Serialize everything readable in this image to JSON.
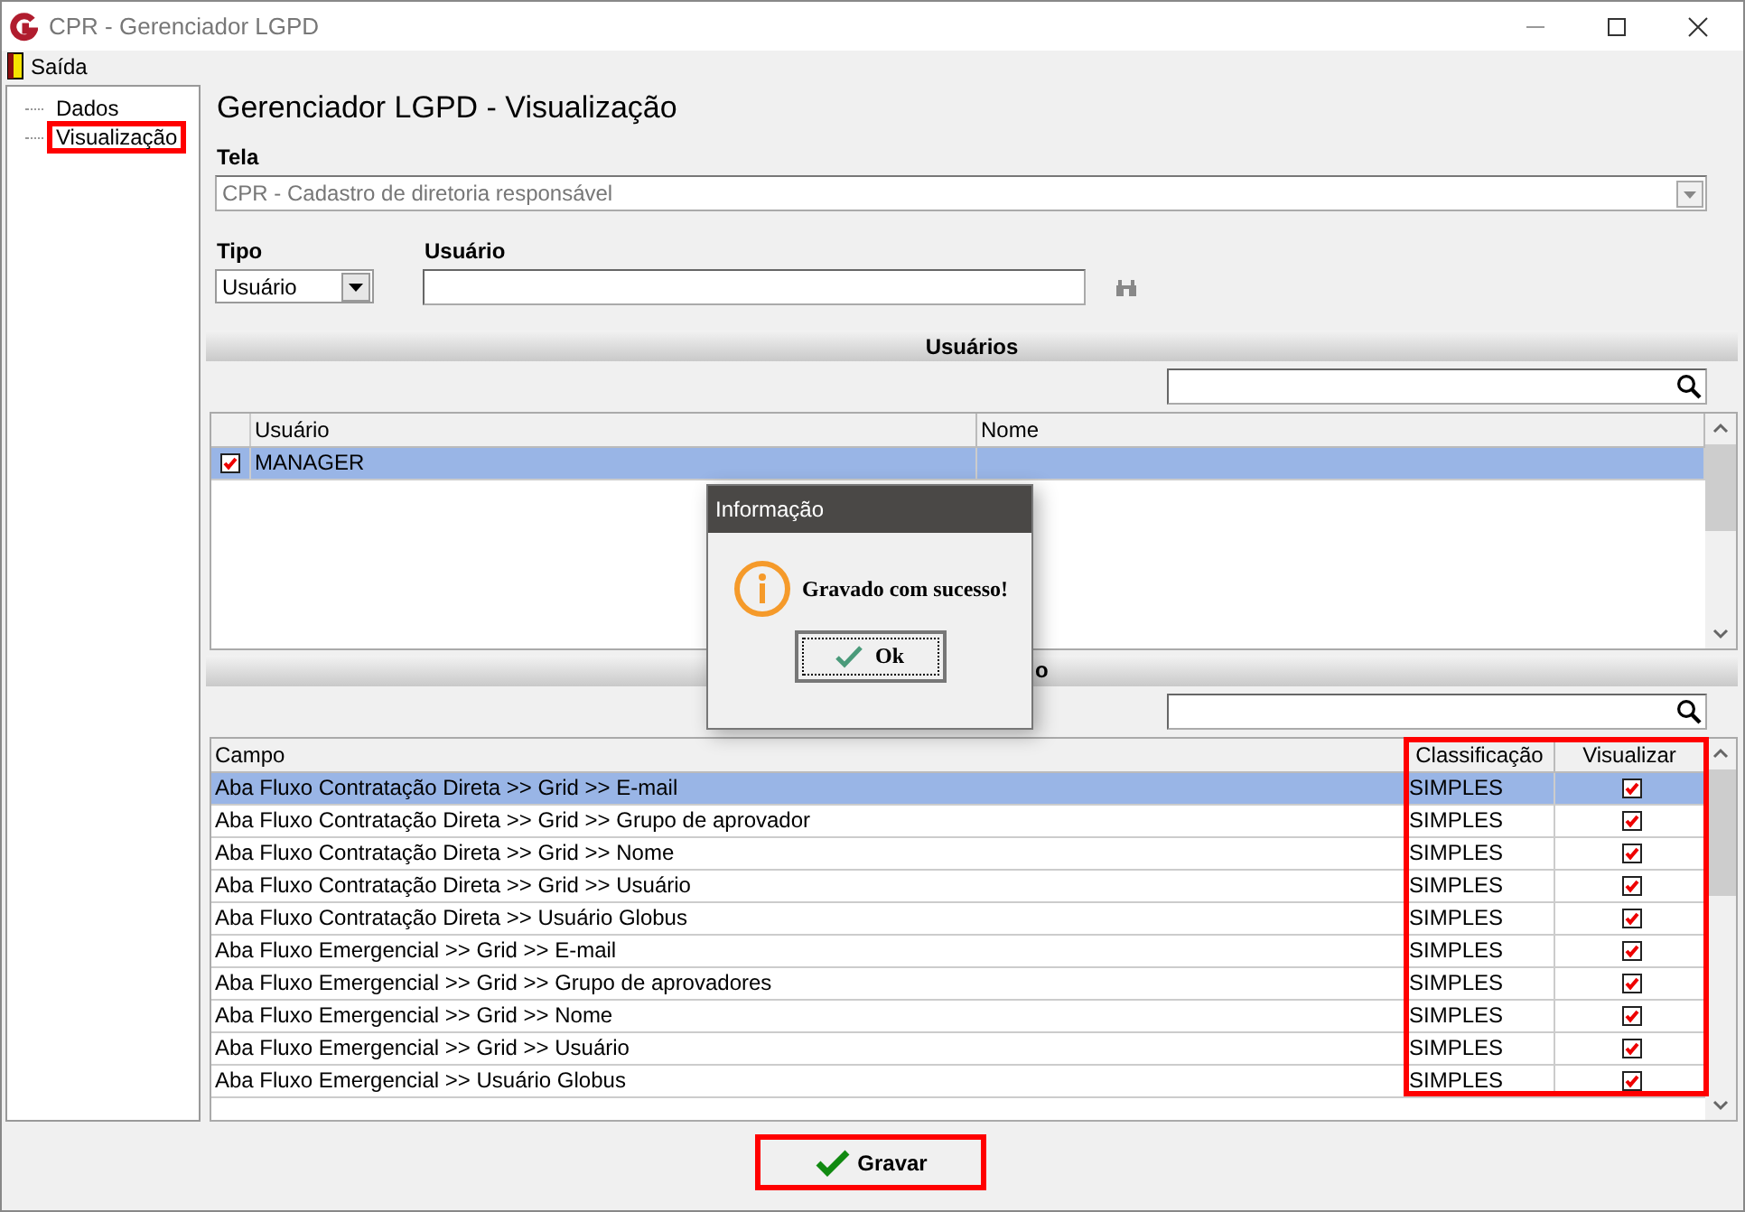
{
  "window": {
    "title": "CPR - Gerenciador LGPD"
  },
  "menu": [
    {
      "label": "Saída"
    }
  ],
  "tree": {
    "items": [
      {
        "label": "Dados",
        "highlighted": false
      },
      {
        "label": "Visualização",
        "highlighted": true
      }
    ]
  },
  "heading": "Gerenciador LGPD - Visualização",
  "tela": {
    "label": "Tela",
    "value": "CPR - Cadastro de diretoria responsável"
  },
  "tipo": {
    "label": "Tipo",
    "value": "Usuário"
  },
  "usuario": {
    "label": "Usuário"
  },
  "users_section": {
    "title": "Usuários",
    "columns": [
      "Usuário",
      "Nome"
    ],
    "rows": [
      {
        "checked": true,
        "usuario": "MANAGER",
        "selected": true
      }
    ]
  },
  "fields_section": {
    "title_visible": "o",
    "columns": [
      "Campo",
      "Classificação",
      "Visualizar"
    ],
    "highlight_columns": true,
    "rows": [
      {
        "campo": "Aba Fluxo Contratação Direta >> Grid >> E-mail",
        "classificacao": "SIMPLES",
        "visualizar": true,
        "selected": true
      },
      {
        "campo": "Aba Fluxo Contratação Direta >> Grid >> Grupo de aprovador",
        "classificacao": "SIMPLES",
        "visualizar": true,
        "selected": false
      },
      {
        "campo": "Aba Fluxo Contratação Direta >> Grid >> Nome",
        "classificacao": "SIMPLES",
        "visualizar": true,
        "selected": false
      },
      {
        "campo": "Aba Fluxo Contratação Direta >> Grid >> Usuário",
        "classificacao": "SIMPLES",
        "visualizar": true,
        "selected": false
      },
      {
        "campo": "Aba Fluxo Contratação Direta >> Usuário Globus",
        "classificacao": "SIMPLES",
        "visualizar": true,
        "selected": false
      },
      {
        "campo": "Aba Fluxo Emergencial >> Grid >> E-mail",
        "classificacao": "SIMPLES",
        "visualizar": true,
        "selected": false
      },
      {
        "campo": "Aba Fluxo Emergencial >> Grid >> Grupo de aprovadores",
        "classificacao": "SIMPLES",
        "visualizar": true,
        "selected": false
      },
      {
        "campo": "Aba Fluxo Emergencial >> Grid >> Nome",
        "classificacao": "SIMPLES",
        "visualizar": true,
        "selected": false
      },
      {
        "campo": "Aba Fluxo Emergencial >> Grid >> Usuário",
        "classificacao": "SIMPLES",
        "visualizar": true,
        "selected": false
      },
      {
        "campo": "Aba Fluxo Emergencial >> Usuário Globus",
        "classificacao": "SIMPLES",
        "visualizar": true,
        "selected": false
      }
    ]
  },
  "save_button": {
    "label": "Gravar",
    "highlighted": true
  },
  "dialog": {
    "title": "Informação",
    "message": "Gravado com sucesso!",
    "button": "Ok"
  }
}
